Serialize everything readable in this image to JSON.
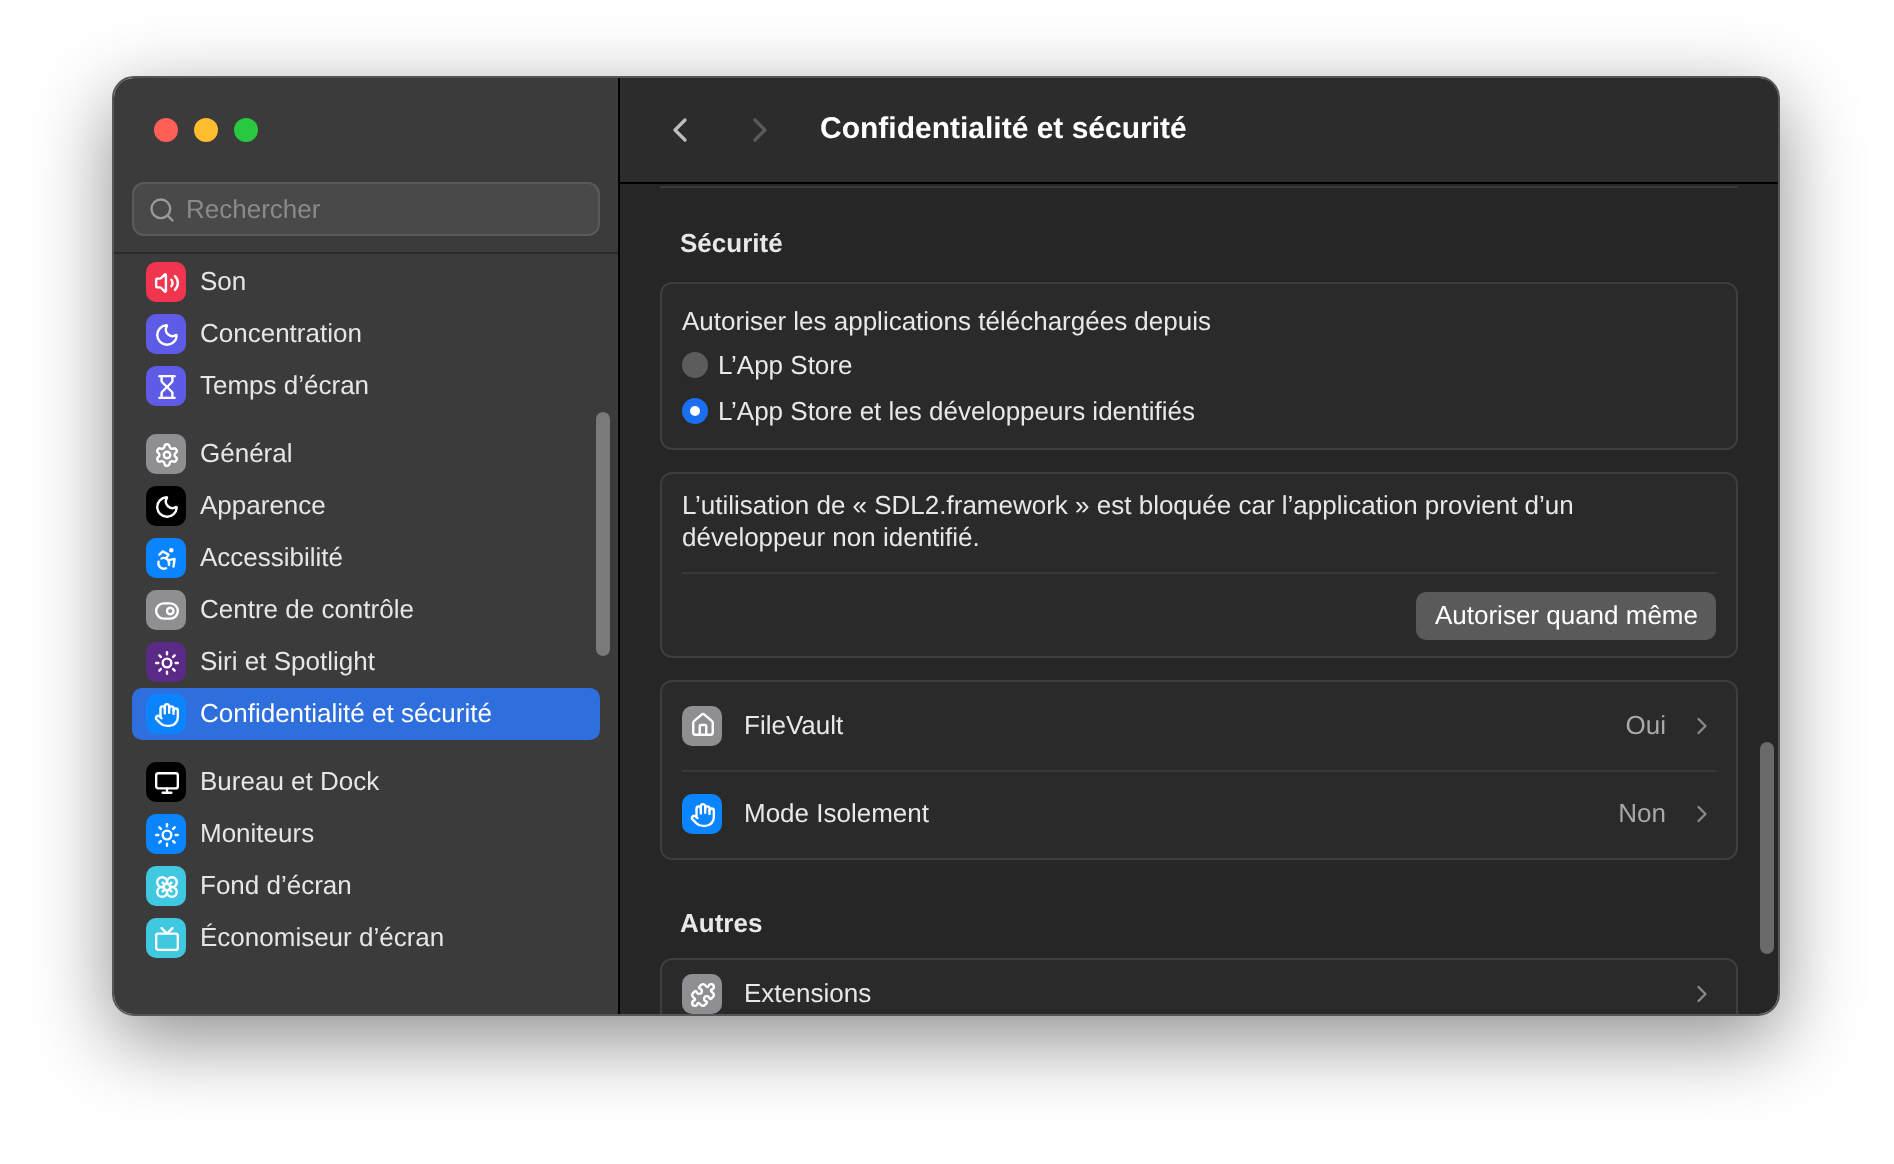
{
  "search": {
    "placeholder": "Rechercher"
  },
  "sidebar": {
    "groups": [
      {
        "items": [
          {
            "label": "Son",
            "selected": false
          },
          {
            "label": "Concentration",
            "selected": false
          },
          {
            "label": "Temps d’écran",
            "selected": false
          }
        ]
      },
      {
        "items": [
          {
            "label": "Général",
            "selected": false
          },
          {
            "label": "Apparence",
            "selected": false
          },
          {
            "label": "Accessibilité",
            "selected": false
          },
          {
            "label": "Centre de contrôle",
            "selected": false
          },
          {
            "label": "Siri et Spotlight",
            "selected": false
          },
          {
            "label": "Confidentialité et sécurité",
            "selected": true
          }
        ]
      },
      {
        "items": [
          {
            "label": "Bureau et Dock",
            "selected": false
          },
          {
            "label": "Moniteurs",
            "selected": false
          },
          {
            "label": "Fond d’écran",
            "selected": false
          },
          {
            "label": "Économiseur d’écran",
            "selected": false
          }
        ]
      }
    ]
  },
  "header": {
    "title": "Confidentialité et sécurité"
  },
  "security": {
    "heading": "Sécurité",
    "allow_label": "Autoriser les applications téléchargées depuis",
    "options": [
      {
        "label": "L’App Store",
        "selected": false
      },
      {
        "label": "L’App Store et les développeurs identifiés",
        "selected": true
      }
    ],
    "blocked_message": "L’utilisation de « SDL2.framework » est bloquée car l’application provient d’un développeur non identifié.",
    "allow_button": "Autoriser quand même",
    "rows": [
      {
        "label": "FileVault",
        "value": "Oui"
      },
      {
        "label": "Mode Isolement",
        "value": "Non"
      }
    ]
  },
  "others": {
    "heading": "Autres",
    "rows": [
      {
        "label": "Extensions"
      }
    ]
  }
}
